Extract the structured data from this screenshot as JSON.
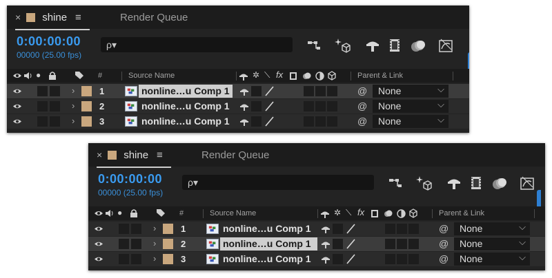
{
  "panels": [
    {
      "tab": {
        "close": "×",
        "name": "shine",
        "menu": "≡",
        "render_queue": "Render Queue"
      },
      "timecode": "0:00:00:00",
      "fps": "00000 (25.00 fps)",
      "search": {
        "glyph": "ρ▾"
      },
      "header": {
        "num": "#",
        "source": "Source Name",
        "parent": "Parent & Link",
        "fx": "fx"
      },
      "selected_row": 1,
      "layers": [
        {
          "num": "1",
          "name": "nonline…u Comp 1",
          "parent": "None"
        },
        {
          "num": "2",
          "name": "nonline…u Comp 1",
          "parent": "None"
        },
        {
          "num": "3",
          "name": "nonline…u Comp 1",
          "parent": "None"
        }
      ]
    },
    {
      "tab": {
        "close": "×",
        "name": "shine",
        "menu": "≡",
        "render_queue": "Render Queue"
      },
      "timecode": "0:00:00:00",
      "fps": "00000 (25.00 fps)",
      "search": {
        "glyph": "ρ▾"
      },
      "header": {
        "num": "#",
        "source": "Source Name",
        "parent": "Parent & Link",
        "fx": "fx"
      },
      "selected_row": 2,
      "layers": [
        {
          "num": "1",
          "name": "nonline…u Comp 1",
          "parent": "None"
        },
        {
          "num": "2",
          "name": "nonline…u Comp 1",
          "parent": "None"
        },
        {
          "num": "3",
          "name": "nonline…u Comp 1",
          "parent": "None"
        }
      ]
    }
  ],
  "glyphs": {
    "chevron": "›",
    "dropdown_arrow": "⌵",
    "spiral": "@",
    "dot": "●"
  },
  "colors": {
    "label_tan": "#c9a77e",
    "timecode_blue": "#3a9bf0",
    "accent_blue": "#2d7fd3"
  }
}
